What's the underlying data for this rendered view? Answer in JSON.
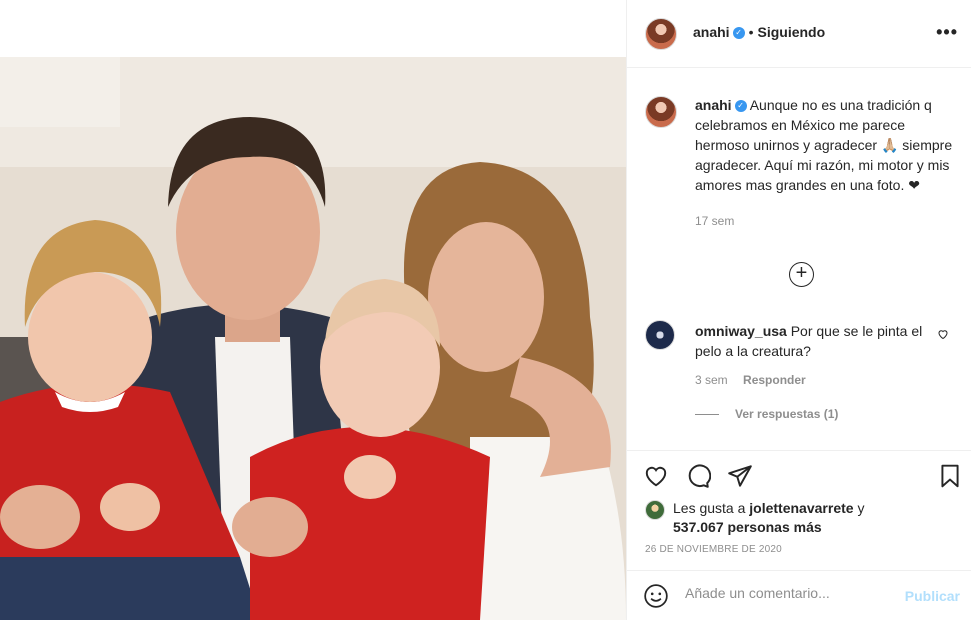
{
  "post": {
    "username": "anahi",
    "follow_status": "Siguiendo",
    "more_label": "•••",
    "caption_user": "anahi",
    "caption_text": "Aunque no es una tradición q celebramos en México me parece hermoso unirnos y agradecer 🙏🏼 siempre agradecer. Aquí mi razón, mi motor y mis amores mas grandes en una foto. ❤",
    "caption_age": "17 sem",
    "load_more_symbol": "+"
  },
  "comments": [
    {
      "user": "omniway_usa",
      "text": "Por que se le pinta el pelo a la creatura?",
      "age": "3 sem",
      "reply_label": "Responder",
      "view_replies": "Ver respuestas (1)"
    }
  ],
  "likes": {
    "prefix": "Les gusta a",
    "user": "jolettenavarrete",
    "conj": "y",
    "others": "537.067 personas más"
  },
  "date": "26 DE NOVIEMBRE DE 2020",
  "comment_box": {
    "placeholder": "Añade un comentario...",
    "publish_label": "Publicar"
  },
  "icons": [
    "heart-icon",
    "comment-icon",
    "share-icon",
    "bookmark-icon",
    "emoji-icon",
    "verified-icon",
    "plus-circle-icon"
  ],
  "colors": {
    "verified": "#3897f0",
    "publish_disabled": "#b2dffc",
    "text_secondary": "#8e8e8e"
  }
}
